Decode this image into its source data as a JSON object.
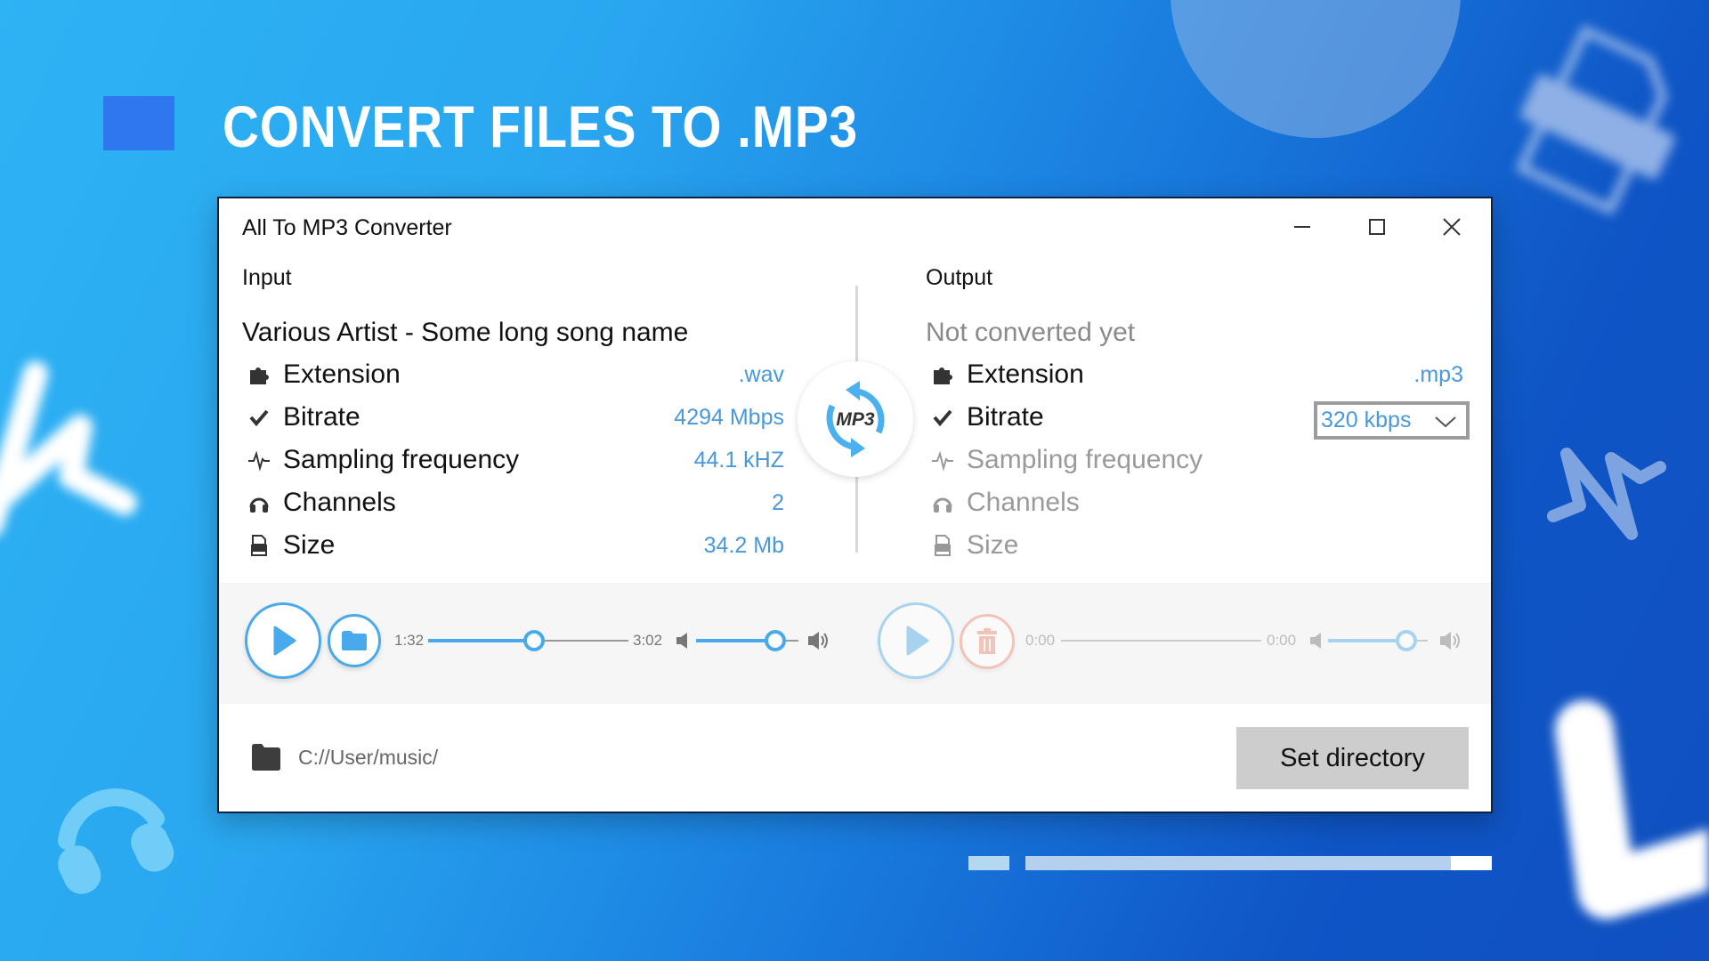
{
  "hero": {
    "title": "CONVERT FILES TO .MP3"
  },
  "window": {
    "title": "All To MP3 Converter",
    "controls": {
      "minimize": "minimize-icon",
      "maximize": "maximize-icon",
      "close": "close-icon"
    }
  },
  "input": {
    "section_label": "Input",
    "track_title": "Various Artist - Some long song name",
    "properties": [
      {
        "icon": "puzzle-icon",
        "label": "Extension",
        "value": ".wav"
      },
      {
        "icon": "check-icon",
        "label": "Bitrate",
        "value": "4294 Mbps"
      },
      {
        "icon": "pulse-icon",
        "label": "Sampling frequency",
        "value": "44.1 kHZ"
      },
      {
        "icon": "headphones-icon",
        "label": "Channels",
        "value": "2"
      },
      {
        "icon": "file-icon",
        "label": "Size",
        "value": "34.2 Mb"
      }
    ],
    "player": {
      "current_time": "1:32",
      "total_time": "3:02",
      "progress": 0.53,
      "volume": 0.77
    }
  },
  "center_badge": {
    "text": "MP3",
    "icon": "convert-arrows-icon"
  },
  "output": {
    "section_label": "Output",
    "track_title": "Not converted yet",
    "properties": [
      {
        "icon": "puzzle-icon",
        "label": "Extension",
        "value": ".mp3"
      },
      {
        "icon": "check-icon",
        "label": "Bitrate",
        "value": "320 kbps"
      },
      {
        "icon": "pulse-icon",
        "label": "Sampling frequency",
        "value": ""
      },
      {
        "icon": "headphones-icon",
        "label": "Channels",
        "value": ""
      },
      {
        "icon": "file-icon",
        "label": "Size",
        "value": ""
      }
    ],
    "bitrate_dropdown": {
      "selected": "320 kbps"
    },
    "player": {
      "current_time": "0:00",
      "total_time": "0:00",
      "progress": 0,
      "volume": 0.79
    }
  },
  "footer": {
    "directory_path": "C://User/music/",
    "set_directory_label": "Set directory"
  },
  "colors": {
    "accent": "#49aaeb",
    "value_text": "#4a98dc",
    "delete": "#f0a090"
  }
}
